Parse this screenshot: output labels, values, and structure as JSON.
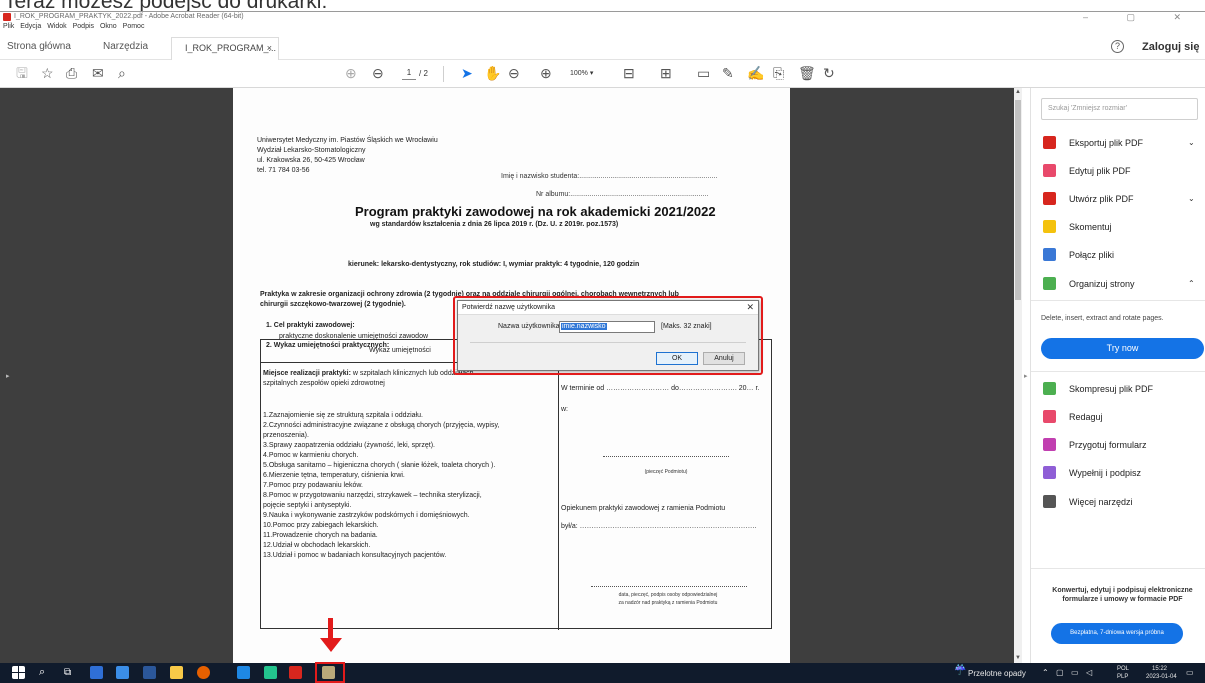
{
  "instruction": "Teraz możesz podejść do drukarki:",
  "window": {
    "title": "I_ROK_PROGRAM_PRAKTYK_2022.pdf - Adobe Acrobat Reader (64-bit)",
    "controls": "–  ▢  ✕"
  },
  "menu": [
    "Plik",
    "Edycja",
    "Widok",
    "Podpis",
    "Okno",
    "Pomoc"
  ],
  "tabs": {
    "home": "Strona główna",
    "tools": "Narzędzia",
    "doc": "I_ROK_PROGRAM_...",
    "doc_close": "×",
    "help": "?",
    "login": "Zaloguj się"
  },
  "toolbar": {
    "page_current": "1",
    "page_total": "/ 2",
    "zoom": "100%"
  },
  "document": {
    "header_lines": [
      "Uniwersytet Medyczny im. Piastów Śląskich we Wrocławiu",
      "Wydział Lekarsko-Stomatologiczny",
      "ul. Krakowska 26, 50-425 Wrocław",
      "tel. 71 784 03-56"
    ],
    "student_name": "Imię i nazwisko studenta:.......................................................................",
    "album_no": "Nr albumu:.......................................................................",
    "title": "Program praktyki zawodowej na rok akademicki 2021/2022",
    "subtitle": "wg standardów kształcenia z dnia 26 lipca 2019 r. (Dz. U. z 2019r. poz.1573)",
    "direction": "kierunek: lekarsko-dentystyczny, rok studiów: I, wymiar praktyk: 4 tygodnie, 120 godzin",
    "section_1": "Praktyka w zakresie organizacji ochrony zdrowia (2 tygodnie) oraz na oddziale chirurgii ogólnej, chorobach wewnętrznych lub",
    "section_2": "chirurgii szczękowo-twarzowej (2 tygodnie).",
    "goal_head": "1.  Cel praktyki zawodowej:",
    "goal_text": "praktyczne doskonalenie umiejętności zawodow",
    "skills_head": "2.  Wykaz umiejętności praktycznych:",
    "table_head": "Wykaz umiejętności",
    "place_bold": "Miejsce realizacji praktyki:",
    "place_rest": " w szpitalach klinicznych lub oddziałach",
    "place_line2": "szpitalnych zespołów opieki zdrowotnej",
    "tasks": [
      "1.Zaznajomienie się ze strukturą szpitala i oddziału.",
      "2.Czynności administracyjne związane z obsługą chorych (przyjęcia, wypisy,",
      "przenoszenia).",
      "3.Sprawy zaopatrzenia oddziału (żywność, leki, sprzęt).",
      "4.Pomoc w karmieniu chorych.",
      "5.Obsługa sanitarno – higieniczna  chorych ( słanie łóżek, toaleta chorych ).",
      "6.Mierzenie  tętna, temperatury, ciśnienia krwi.",
      "7.Pomoc przy podawaniu leków.",
      "8.Pomoc w przygotowaniu narzędzi, strzykawek – technika sterylizacji,",
      "pojęcie septyki i antyseptyki.",
      "9.Nauka i wykonywanie zastrzyków podskórnych i domięśniowych.",
      "10.Pomoc przy zabiegach lekarskich.",
      "11.Prowadzenie chorych na badania.",
      "12.Udział w obchodach  lekarskich.",
      "13.Udział i pomoc w badaniach konsultacyjnych pacjentów."
    ],
    "term": "W terminie od ……………………… do……………………. 20… r.",
    "in": "w:",
    "stamp": "(pieczęć Podmiotu)",
    "supervisor": "Opiekunem praktyki zawodowej z ramienia Podmiotu",
    "was": "był/a: ………………………………………………………………….",
    "sign_1": "data, pieczęć,  podpis osoby odpowiedzialnej",
    "sign_2": "za nadzór nad praktyką z ramienia Podmiotu"
  },
  "dialog": {
    "title": "Potwierdź nazwę użytkownika",
    "close": "✕",
    "label": "Nazwa użytkownika:",
    "value": "imie.nazwisko",
    "hint": "[Maks. 32 znaki]",
    "ok": "OK",
    "cancel": "Anuluj"
  },
  "right_panel": {
    "search_placeholder": "Szukaj 'Zmniejsz rozmiar'",
    "items": [
      {
        "label": "Eksportuj plik PDF",
        "color": "#d7261e",
        "chevron": "⌄"
      },
      {
        "label": "Edytuj plik PDF",
        "color": "#e8496b",
        "chevron": ""
      },
      {
        "label": "Utwórz plik PDF",
        "color": "#d7261e",
        "chevron": "⌄"
      },
      {
        "label": "Skomentuj",
        "color": "#f4c20d",
        "chevron": ""
      },
      {
        "label": "Połącz pliki",
        "color": "#3a78d6",
        "chevron": ""
      },
      {
        "label": "Organizuj strony",
        "color": "#4caf50",
        "chevron": "⌃"
      }
    ],
    "organize_desc": "Delete, insert, extract and rotate pages.",
    "try_now": "Try now",
    "items2": [
      {
        "label": "Skompresuj plik PDF",
        "color": "#4caf50"
      },
      {
        "label": "Redaguj",
        "color": "#e8496b"
      },
      {
        "label": "Przygotuj formularz",
        "color": "#c13fb0"
      },
      {
        "label": "Wypełnij i podpisz",
        "color": "#8f5ed6"
      },
      {
        "label": "Więcej narzędzi",
        "color": "#555555"
      }
    ],
    "promo": "Konwertuj, edytuj i podpisuj elektroniczne formularze i umowy w formacie PDF",
    "trial": "Bezpłatna, 7-dniowa wersja próbna"
  },
  "taskbar": {
    "weather": "Przelotne opady",
    "lang_1": "POL",
    "lang_2": "PLP",
    "time": "15:22",
    "date": "2023-01-04"
  }
}
